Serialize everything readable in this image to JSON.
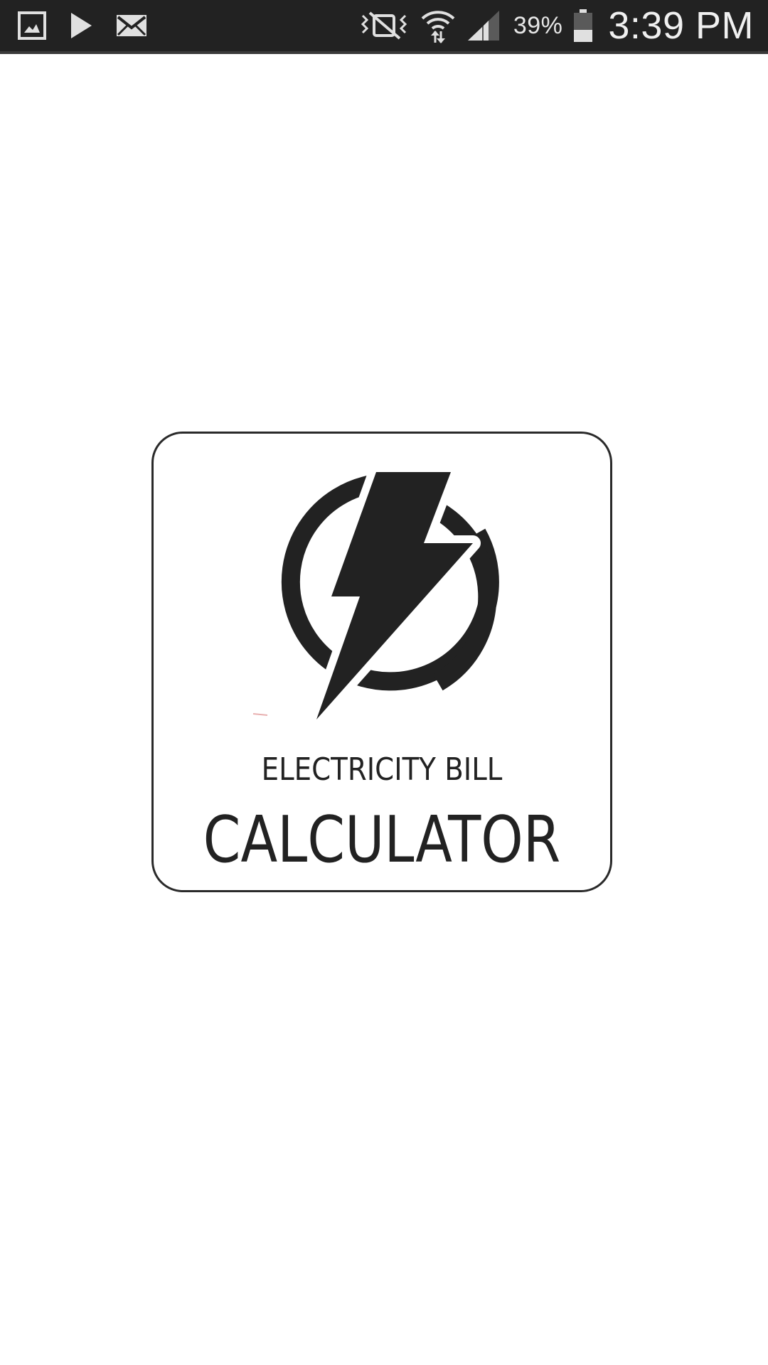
{
  "status_bar": {
    "notification_icons": [
      "gallery-icon",
      "play-store-icon",
      "email-icon"
    ],
    "system_icons": [
      "vibrate-mute-icon",
      "wifi-icon",
      "signal-icon",
      "battery-icon"
    ],
    "battery_percent": "39%",
    "time": "3:39 PM",
    "colors": {
      "background": "#222222",
      "foreground": "#e6e6e6"
    }
  },
  "splash": {
    "logo_icon": "lightning-power-icon",
    "title_line1": "ELECTRICITY BILL",
    "title_line2": "CALCULATOR",
    "colors": {
      "ink": "#222222",
      "background": "#ffffff"
    }
  }
}
